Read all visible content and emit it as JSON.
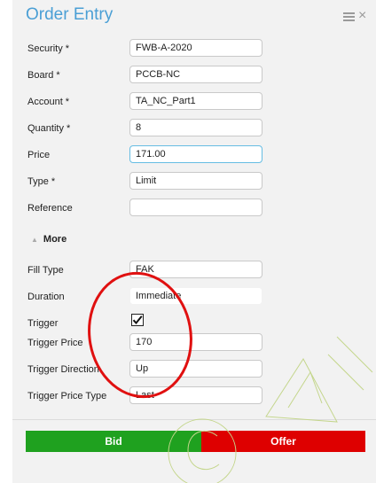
{
  "window": {
    "title": "Order Entry",
    "menu_icon": "hamburger-menu-icon",
    "close_icon": "close-icon",
    "close_glyph": "×"
  },
  "fields": [
    {
      "label": "Security *",
      "value": "FWB-A-2020"
    },
    {
      "label": "Board *",
      "value": "PCCB-NC"
    },
    {
      "label": "Account *",
      "value": "TA_NC_Part1"
    },
    {
      "label": "Quantity *",
      "value": "8"
    },
    {
      "label": "Price",
      "value": "171.00"
    },
    {
      "label": "Type *",
      "value": "Limit"
    },
    {
      "label": "Reference",
      "value": ""
    }
  ],
  "more": {
    "arrow": "▲",
    "label": "More"
  },
  "more_fields": [
    {
      "label": "Fill Type",
      "value": "FAK"
    },
    {
      "label": "Duration",
      "value": "Immediate"
    },
    {
      "label": "Trigger",
      "checked": true
    },
    {
      "label": "Trigger Price",
      "value": "170"
    },
    {
      "label": "Trigger Direction",
      "value": "Up"
    },
    {
      "label": "Trigger Price Type",
      "value": "Last"
    }
  ],
  "buttons": {
    "bid": "Bid",
    "offer": "Offer"
  },
  "colors": {
    "title": "#4a9fd5",
    "bid": "#1fa11f",
    "offer": "#de0000",
    "annotation_circle": "#e01010"
  }
}
